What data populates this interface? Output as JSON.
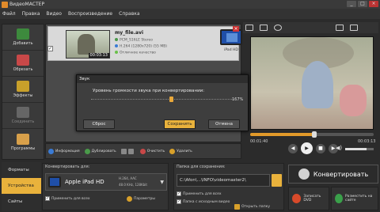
{
  "window": {
    "title": "ВидеоМАСТЕР",
    "min": "_",
    "max": "□",
    "close": "×"
  },
  "menu": [
    "Файл",
    "Правка",
    "Видео",
    "Воспроизведение",
    "Справка"
  ],
  "sidebar": [
    {
      "label": "Добавить",
      "icon": "add-video-icon",
      "color": "#3d8a3d"
    },
    {
      "label": "Обрезать",
      "icon": "cut-icon",
      "color": "#c84848"
    },
    {
      "label": "Эффекты",
      "icon": "effects-icon",
      "color": "#c8a02a"
    },
    {
      "label": "Соединить",
      "icon": "join-icon",
      "color": "#777777"
    },
    {
      "label": "Программы",
      "icon": "programs-icon",
      "color": "#d8a04a"
    }
  ],
  "file": {
    "name": "my_file.avi",
    "duration": "00:03:13",
    "audio": "PCM_S16LE Stereo",
    "video": "H.264 (1280x720) (55 MB)",
    "quality": "Отличное качество",
    "device": "iPad HD",
    "remove": "×",
    "check": "✓"
  },
  "toolbar": [
    {
      "label": "Информация",
      "color": "#3a7bd5"
    },
    {
      "label": "Дублировать",
      "color": "#4a9a4a"
    },
    {
      "label": "Очистить",
      "color": "#c84848"
    },
    {
      "label": "Удалить",
      "color": "#d8a02a"
    }
  ],
  "player": {
    "time_start": "00:01:40",
    "time_end": "00:03:13",
    "progress": 0.52,
    "volume": 0.75,
    "prev": "◀",
    "play": "▶",
    "stop": "■",
    "next": "▶",
    "volume_glyph": "◀)"
  },
  "dialog": {
    "title": "Звук",
    "label": "Уровень громкости звука при конвертировании:",
    "value_pct": "167%",
    "level": 0.56,
    "reset": "Сброс",
    "save": "Сохранить",
    "cancel": "Отмена"
  },
  "bottom_tabs": [
    "Форматы",
    "Устройства",
    "Сайты"
  ],
  "convert_for": {
    "title": "Конвертировать для:",
    "device": "Apple iPad HD",
    "spec1": "H.264, AAC",
    "spec2": "48.0 KHz, 128Kbit",
    "arrow": "▼",
    "apply_all": "Применить для всех",
    "params": "Параметры",
    "check": "✓"
  },
  "save_folder": {
    "title": "Папка для сохранения:",
    "path": "C:\\Afon\\...\\INFO\\videomaster2\\",
    "apply_all": "Применить для всех",
    "with_source": "Папка с исходным видео",
    "open_folder": "Открыть папку",
    "check": "✓"
  },
  "actions": {
    "convert": "Конвертировать",
    "dvd": "Записать DVD",
    "web": "Разместить на сайте"
  }
}
